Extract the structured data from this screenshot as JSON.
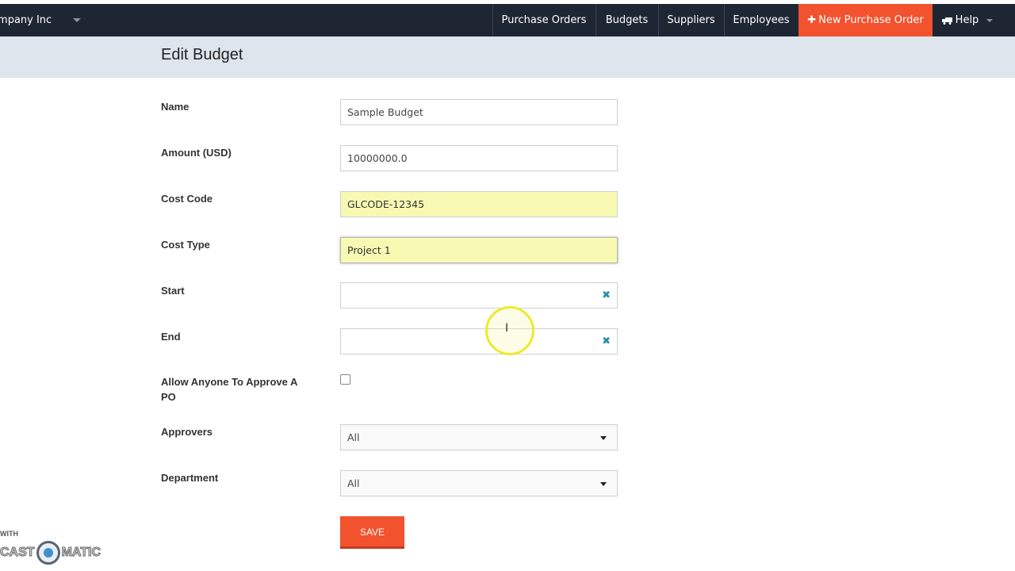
{
  "nav": {
    "company": "Company Inc",
    "links": {
      "purchase_orders": "Purchase Orders",
      "budgets": "Budgets",
      "suppliers": "Suppliers",
      "employees": "Employees",
      "new_purchase_order": "New Purchase Order",
      "help": "Help"
    }
  },
  "page": {
    "title": "Edit Budget"
  },
  "form": {
    "name": {
      "label": "Name",
      "value": "Sample Budget"
    },
    "amount": {
      "label": "Amount (USD)",
      "value": "10000000.0"
    },
    "cost_code": {
      "label": "Cost Code",
      "value": "GLCODE-12345"
    },
    "cost_type": {
      "label": "Cost Type",
      "value": "Project 1"
    },
    "start": {
      "label": "Start",
      "value": ""
    },
    "end": {
      "label": "End",
      "value": ""
    },
    "allow_anyone": {
      "label": "Allow Anyone To Approve A PO",
      "checked": false
    },
    "approvers": {
      "label": "Approvers",
      "selected": "All"
    },
    "department": {
      "label": "Department",
      "selected": "All"
    },
    "save_label": "SAVE"
  },
  "icons": {
    "clear": "✖",
    "plus": "✚",
    "ibeam": "I"
  },
  "watermark": {
    "with": "WITH",
    "left": "CAST",
    "right": "MATIC"
  },
  "colors": {
    "accent": "#f2522e",
    "navbar": "#1f2633",
    "highlight": "#f8f9b3",
    "clear_icon": "#2a8fa6"
  }
}
